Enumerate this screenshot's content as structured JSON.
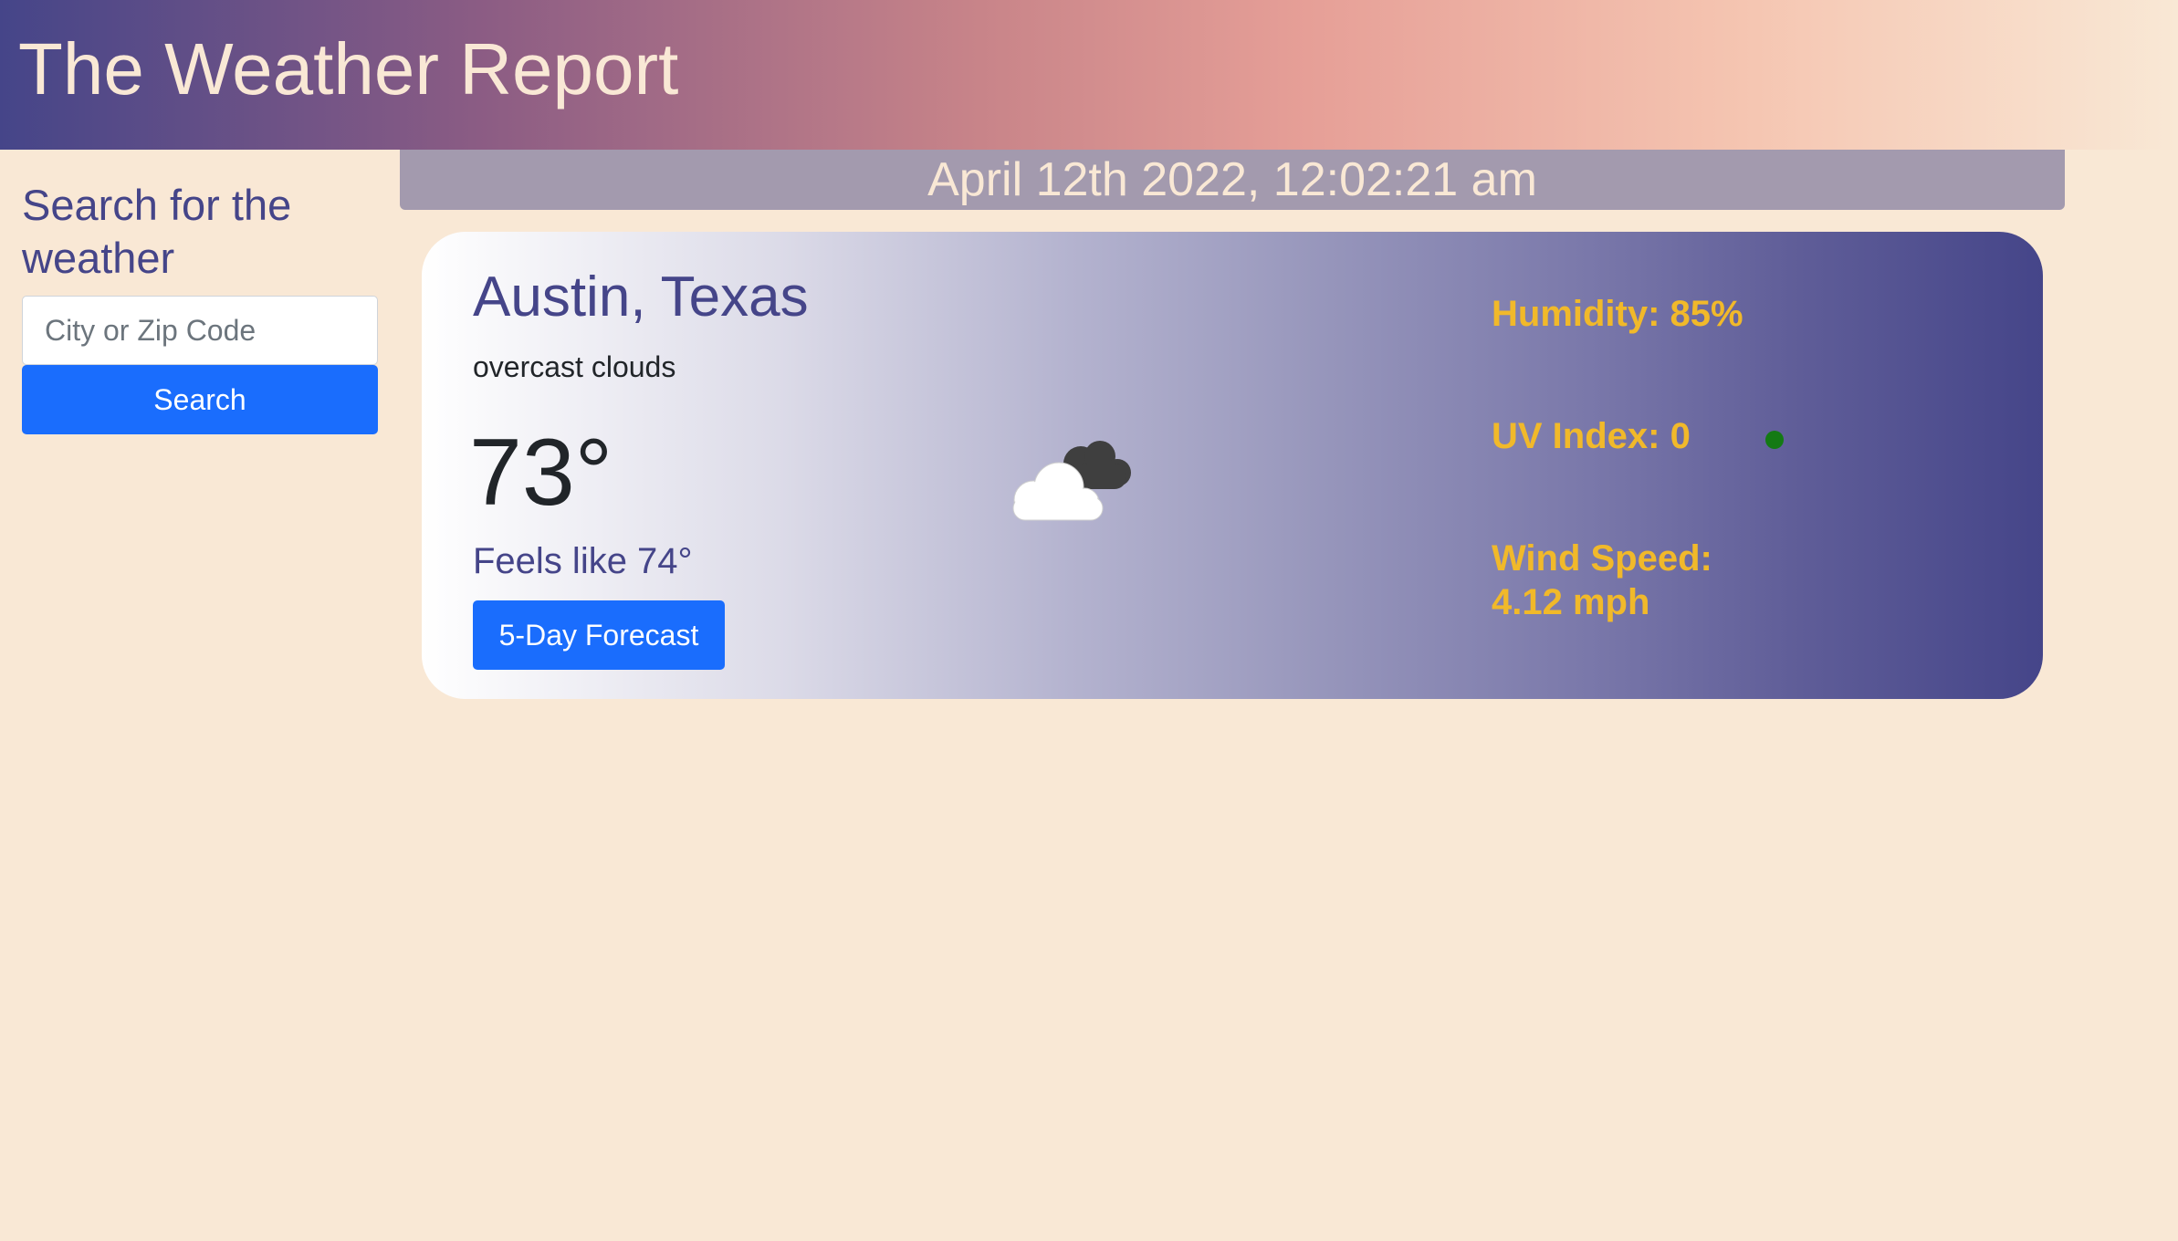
{
  "header": {
    "title": "The Weather Report"
  },
  "sidebar": {
    "title": "Search for the weather",
    "search_placeholder": "City or Zip Code",
    "search_value": "",
    "search_button": "Search"
  },
  "datetime": "April 12th 2022, 12:02:21 am",
  "weather": {
    "city": "Austin, Texas",
    "description": "overcast clouds",
    "temperature": "73°",
    "feels_like": "Feels like 74°",
    "forecast_button": "5-Day Forecast",
    "icon": "overcast-clouds-icon",
    "humidity": "Humidity: 85%",
    "uv_index": "UV Index: 0",
    "uv_indicator_color": "#147a14",
    "wind_label": "Wind Speed:",
    "wind_value": "4.12 mph"
  },
  "colors": {
    "brand": "#454589",
    "background": "#f9e8d5",
    "accent_button": "#1a6dfd",
    "stat_text": "#f1b92a"
  }
}
